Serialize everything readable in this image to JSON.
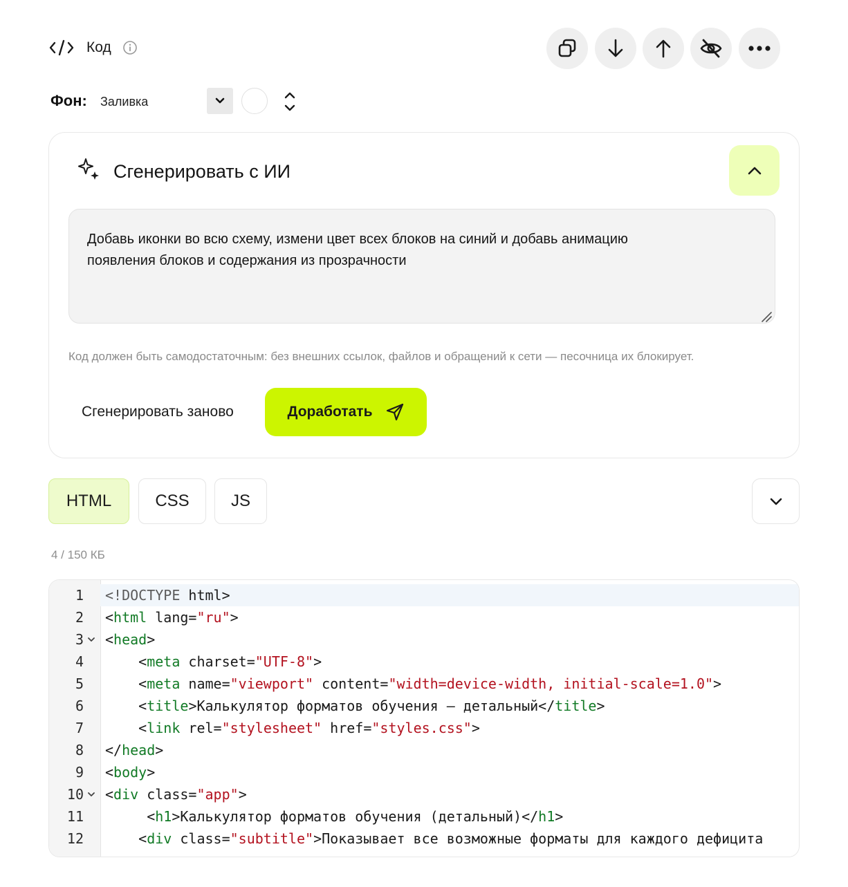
{
  "header": {
    "title": "Код",
    "icons": [
      "code-icon",
      "info-icon"
    ],
    "toolbar": [
      "copy-icon",
      "arrow-down-icon",
      "arrow-up-icon",
      "eye-off-icon",
      "more-icon"
    ]
  },
  "background": {
    "label": "Фон:",
    "fill_value": "Заливка"
  },
  "ai": {
    "title": "Сгенерировать с ИИ",
    "prompt_line1": "Добавь иконки во всю схему, измени цвет всех блоков на синий и добавь анимацию",
    "prompt_line2": "появления блоков и содержания из прозрачности",
    "note": "Код должен быть самодостаточным: без внешних ссылок, файлов и обращений к сети — песочница их блокирует.",
    "regenerate": "Сгенерировать заново",
    "refine": "Доработать",
    "accent": "#ccf500"
  },
  "tabs": [
    "HTML",
    "CSS",
    "JS"
  ],
  "active_tab": "HTML",
  "size": "4 / 150 КБ",
  "code": {
    "numbers": [
      "1",
      "2",
      "3",
      "4",
      "5",
      "6",
      "7",
      "8",
      "9",
      "10",
      "11",
      "12"
    ],
    "l1": {
      "a": "<!DOCTYPE ",
      "b": "html",
      "c": ">"
    },
    "l2": {
      "a": "<",
      "tag": "html",
      "b": " lang=",
      "s1": "\"ru\"",
      "c": ">"
    },
    "l3": {
      "a": "<",
      "tag": "head",
      "c": ">"
    },
    "l4": {
      "a": "    <",
      "tag": "meta",
      "b": " charset=",
      "s1": "\"UTF-8\"",
      "c": ">"
    },
    "l5": {
      "a": "    <",
      "tag": "meta",
      "b": " name=",
      "s1": "\"viewport\"",
      "c": " content=",
      "s2": "\"width=device-width, initial-scale=1.0\"",
      "d": ">"
    },
    "l6": {
      "a": "    <",
      "tag": "title",
      "b": ">Калькулятор форматов обучения — детальный</",
      "tag2": "title",
      "c": ">"
    },
    "l7": {
      "a": "    <",
      "tag": "link",
      "b": " rel=",
      "s1": "\"stylesheet\"",
      "c": " href=",
      "s2": "\"styles.css\"",
      "d": ">"
    },
    "l8": {
      "a": "</",
      "tag": "head",
      "c": ">"
    },
    "l9": {
      "a": "<",
      "tag": "body",
      "c": ">"
    },
    "l10": {
      "a": "<",
      "tag": "div",
      "b": " class=",
      "s1": "\"app\"",
      "c": ">"
    },
    "l11": {
      "a": "     <",
      "tag": "h1",
      "b": ">Калькулятор форматов обучения (детальный)</",
      "tag2": "h1",
      "c": ">"
    },
    "l12": {
      "a": "    <",
      "tag": "div",
      "b": " class=",
      "s1": "\"subtitle\"",
      "c": ">Показывает все возможные форматы для каждого дефицита"
    }
  }
}
